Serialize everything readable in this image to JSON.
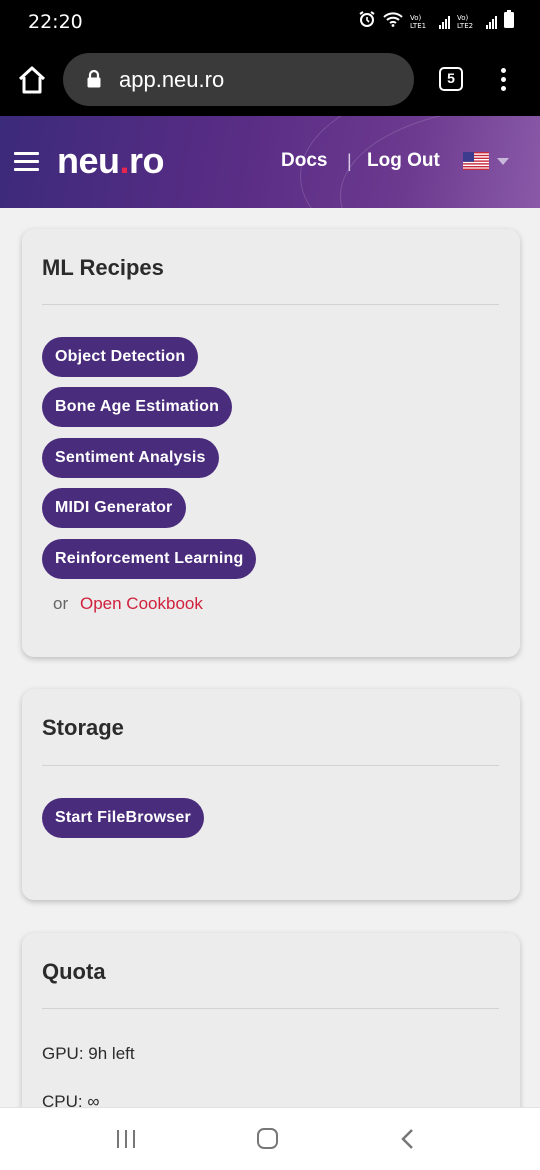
{
  "status_bar": {
    "time": "22:20",
    "sim1_label": "Vo) LTE1",
    "sim2_label": "Vo) LTE2",
    "icons": [
      "alarm-icon",
      "wifi-icon",
      "signal-icon",
      "signal-icon",
      "battery-icon"
    ]
  },
  "browser": {
    "url": "app.neu.ro",
    "tab_count": "5"
  },
  "header": {
    "logo_main": "neu",
    "logo_dot": ".",
    "logo_tld": "ro",
    "docs_label": "Docs",
    "separator": "|",
    "logout_label": "Log Out",
    "language_flag": "us-flag-icon"
  },
  "ml_recipes": {
    "title": "ML Recipes",
    "chips": [
      "Object Detection",
      "Bone Age Estimation",
      "Sentiment Analysis",
      "MIDI Generator",
      "Reinforcement Learning"
    ],
    "or_label": "or",
    "cookbook_label": "Open Cookbook"
  },
  "storage": {
    "title": "Storage",
    "button_label": "Start FileBrowser"
  },
  "quota": {
    "title": "Quota",
    "gpu_line": "GPU: 9h left",
    "cpu_line": "CPU: ∞"
  },
  "colors": {
    "accent": "#4a2c7d",
    "link": "#d0213d",
    "header_gradient_start": "#3c2a7a",
    "header_gradient_end": "#8a5aa8"
  }
}
